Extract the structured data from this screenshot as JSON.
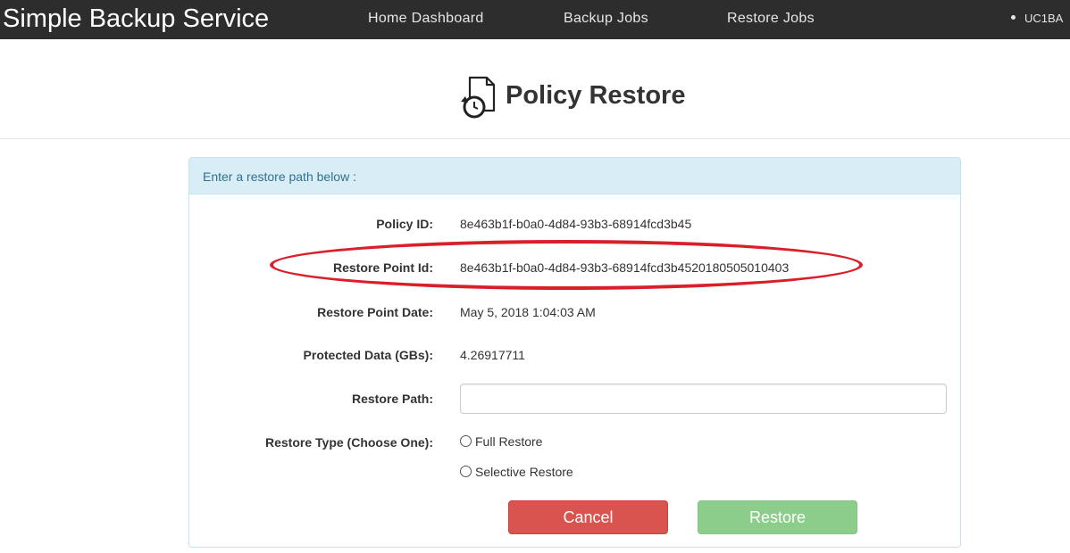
{
  "navbar": {
    "brand": "Simple Backup Service",
    "links": [
      {
        "label": "Home Dashboard"
      },
      {
        "label": "Backup Jobs"
      },
      {
        "label": "Restore Jobs"
      }
    ],
    "user": "UC1BA"
  },
  "header": {
    "title": "Policy Restore",
    "icon": "restore-document-icon"
  },
  "panel": {
    "heading": "Enter a restore path below :",
    "fields": {
      "policy_id": {
        "label": "Policy ID:",
        "value": "8e463b1f-b0a0-4d84-93b3-68914fcd3b45"
      },
      "restore_point_id": {
        "label": "Restore Point Id:",
        "value": "8e463b1f-b0a0-4d84-93b3-68914fcd3b4520180505010403"
      },
      "restore_point_date": {
        "label": "Restore Point Date:",
        "value": "May 5, 2018 1:04:03 AM"
      },
      "protected_data": {
        "label": "Protected Data (GBs):",
        "value": "4.26917711"
      },
      "restore_path": {
        "label": "Restore Path:",
        "value": "",
        "placeholder": ""
      },
      "restore_type": {
        "label": "Restore Type (Choose One):",
        "options": [
          {
            "label": "Full Restore",
            "selected": false
          },
          {
            "label": "Selective Restore",
            "selected": false
          }
        ]
      }
    },
    "buttons": {
      "cancel": "Cancel",
      "restore": "Restore"
    }
  },
  "colors": {
    "navbar_bg": "#2d2d2d",
    "panel_heading_bg": "#d9edf7",
    "panel_border": "#bce8f1",
    "cancel": "#d9534f",
    "restore": "#5cb85c",
    "highlight": "#d9202a"
  }
}
